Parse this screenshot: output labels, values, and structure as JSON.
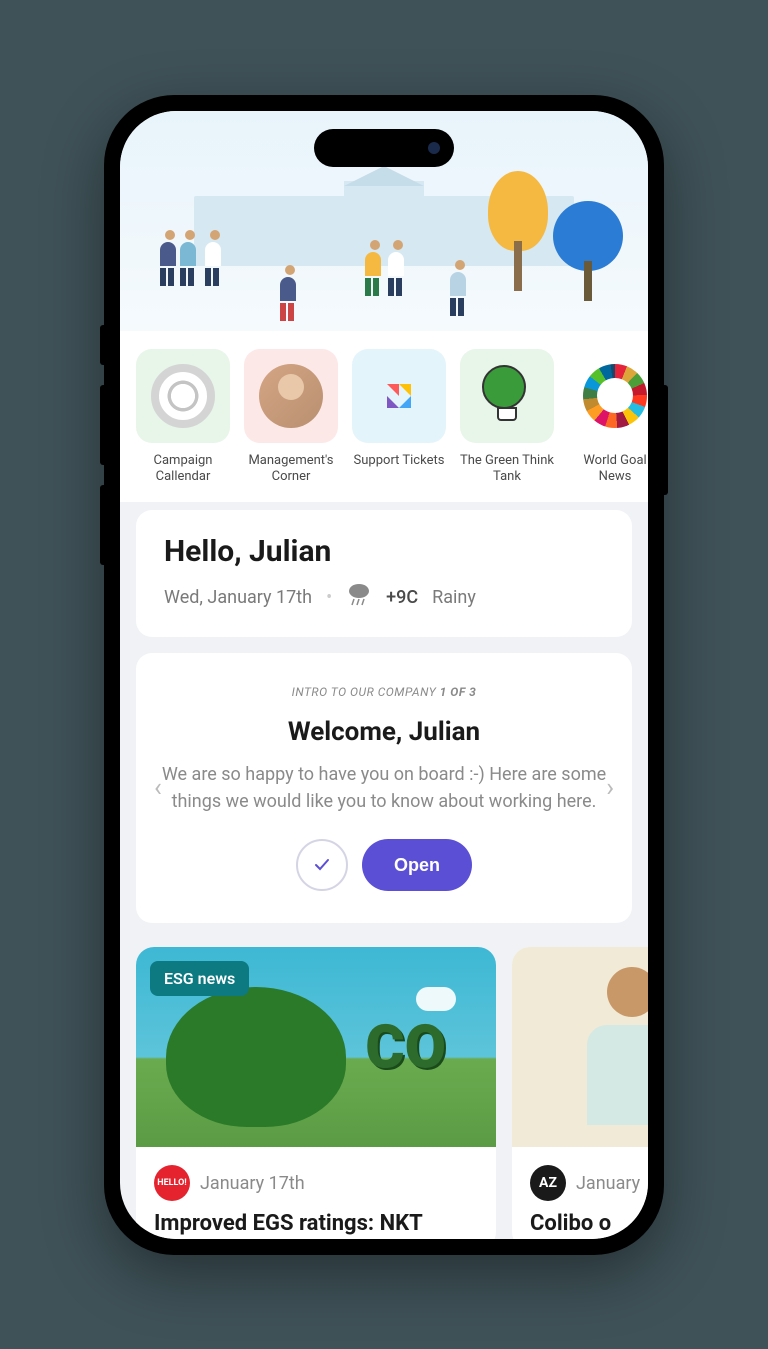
{
  "shortcuts": [
    {
      "label": "Campaign Callendar",
      "bg": "#e8f5e9",
      "icon": "campaign"
    },
    {
      "label": "Management's Corner",
      "bg": "#fde8e8",
      "icon": "management"
    },
    {
      "label": "Support Tickets",
      "bg": "#e4f4fb",
      "icon": "support"
    },
    {
      "label": "The Green Think Tank",
      "bg": "#e8f5e9",
      "icon": "thinktank"
    },
    {
      "label": "World Goal News",
      "bg": "#fff",
      "icon": "goals"
    }
  ],
  "greeting": {
    "title": "Hello, Julian",
    "date": "Wed, January 17th",
    "temp": "+9C",
    "condition": "Rainy"
  },
  "intro": {
    "eyebrow_prefix": "INTRO TO OUR COMPANY ",
    "eyebrow_bold": "1 OF 3",
    "title": "Welcome, Julian",
    "body": "We are so happy to have you on board :-) Here are some things we would like you to know about working here.",
    "open_label": "Open"
  },
  "news": [
    {
      "tag": "ESG news",
      "date": "January 17th",
      "title": "Improved EGS ratings: NKT",
      "avatar_text": "HELLO!",
      "avatar_bg": "#e5232e"
    },
    {
      "date": "January",
      "title": "Colibo o",
      "avatar_text": "AZ",
      "avatar_bg": "#1a1a1a"
    }
  ]
}
